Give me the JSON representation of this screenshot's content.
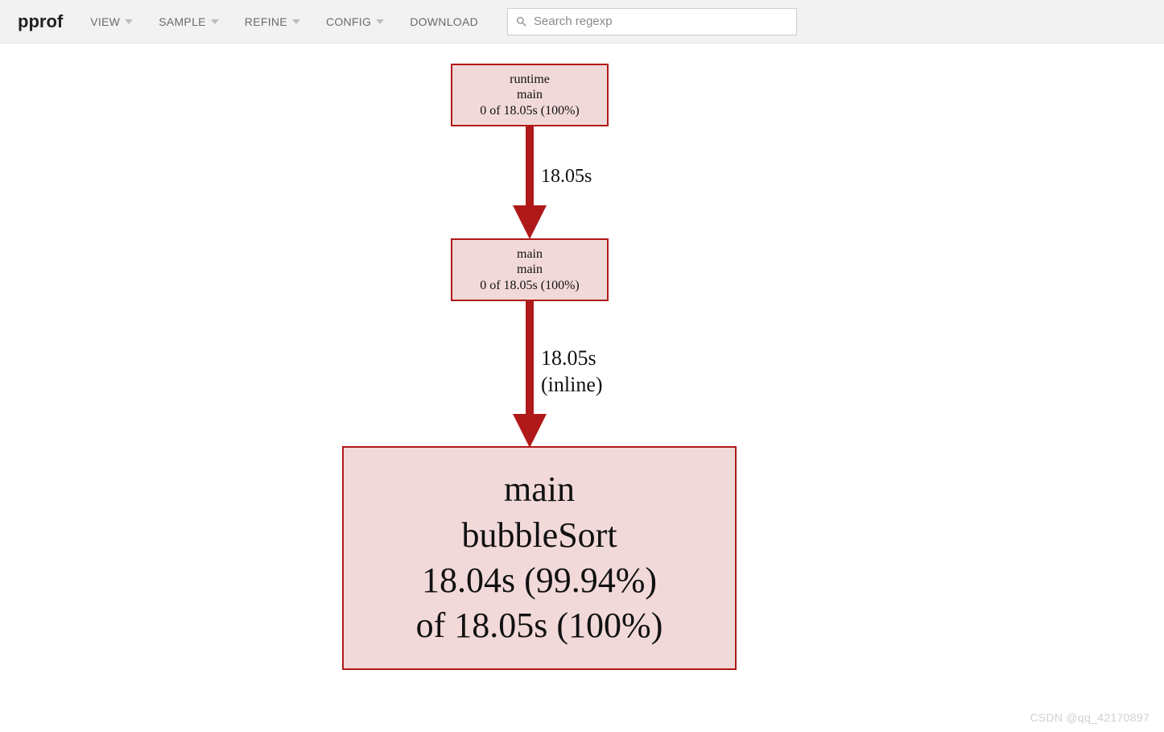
{
  "header": {
    "title": "pprof",
    "menus": {
      "view": "VIEW",
      "sample": "SAMPLE",
      "refine": "REFINE",
      "config": "CONFIG",
      "download": "DOWNLOAD"
    },
    "search_placeholder": "Search regexp"
  },
  "graph": {
    "node1": {
      "line1": "runtime",
      "line2": "main",
      "line3": "0 of 18.05s (100%)"
    },
    "node2": {
      "line1": "main",
      "line2": "main",
      "line3": "0 of 18.05s (100%)"
    },
    "node3": {
      "line1": "main",
      "line2": "bubbleSort",
      "line3": "18.04s (99.94%)",
      "line4": "of 18.05s (100%)"
    },
    "edge1_label": "18.05s",
    "edge2_label_line1": "18.05s",
    "edge2_label_line2": "(inline)"
  },
  "watermark": "CSDN @qq_42170897"
}
